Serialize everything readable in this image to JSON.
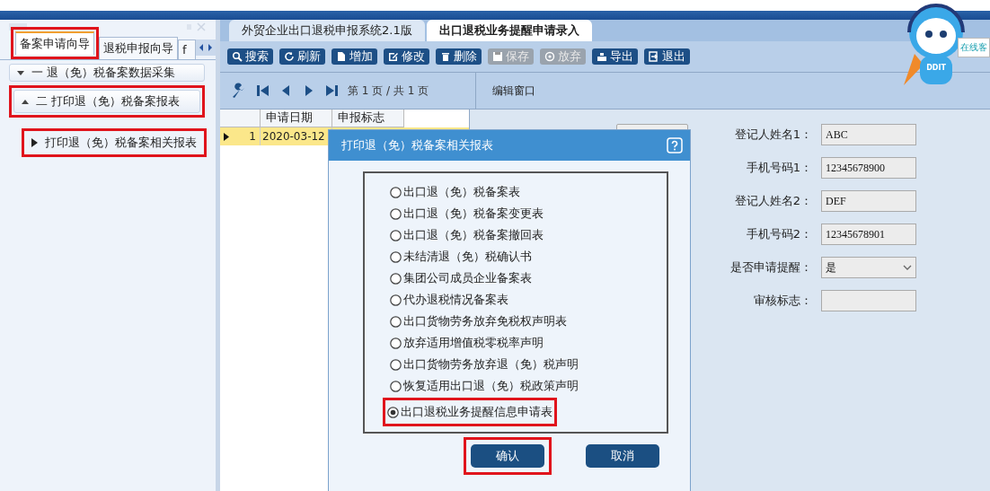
{
  "left_panel": {
    "tabs": [
      {
        "label": "备案申请向导",
        "selected": true,
        "highlighted": true
      },
      {
        "label": "退税申报向导",
        "selected": false,
        "highlighted": false
      },
      {
        "label": "f",
        "selected": false,
        "highlighted": false
      }
    ],
    "tree": [
      {
        "label": "一 退（免）税备案数据采集",
        "expanded": false,
        "highlighted": false
      },
      {
        "label": "二 打印退（免）税备案报表",
        "expanded": true,
        "highlighted": true,
        "children": [
          {
            "label": "打印退（免）税备案相关报表",
            "highlighted": true
          }
        ]
      }
    ]
  },
  "tabs": [
    {
      "label": "外贸企业出口退税申报系统2.1版",
      "selected": false
    },
    {
      "label": "出口退税业务提醒申请录入",
      "selected": true
    }
  ],
  "toolbar": [
    {
      "label": "搜索",
      "kind": "search",
      "disabled": false
    },
    {
      "label": "刷新",
      "kind": "refresh",
      "disabled": false
    },
    {
      "label": "增加",
      "kind": "add",
      "disabled": false
    },
    {
      "label": "修改",
      "kind": "edit",
      "disabled": false
    },
    {
      "label": "删除",
      "kind": "delete",
      "disabled": false
    },
    {
      "label": "保存",
      "kind": "save",
      "disabled": true
    },
    {
      "label": "放弃",
      "kind": "discard",
      "disabled": true
    },
    {
      "label": "导出",
      "kind": "export",
      "disabled": false
    },
    {
      "label": "退出",
      "kind": "exit",
      "disabled": false
    }
  ],
  "pager": {
    "text": "第 1 页 / 共 1 页"
  },
  "edit_window": {
    "title": "编辑窗口"
  },
  "grid": {
    "columns": [
      "申请日期",
      "申报标志"
    ],
    "rows": [
      {
        "index": "1",
        "current": true,
        "cells": [
          "2020-03-12"
        ]
      }
    ]
  },
  "form": {
    "fields": [
      {
        "label": "登记人姓名1：",
        "value": "ABC",
        "kind": "text"
      },
      {
        "label": "手机号码1：",
        "value": "12345678900",
        "kind": "text"
      },
      {
        "label": "登记人姓名2：",
        "value": "DEF",
        "kind": "text"
      },
      {
        "label": "手机号码2：",
        "value": "12345678901",
        "kind": "text"
      },
      {
        "label": "是否申请提醒：",
        "value": "是",
        "kind": "select"
      },
      {
        "label": "审核标志：",
        "kind": "text"
      }
    ]
  },
  "assistant": {
    "badge": "DDIT",
    "bubble": "在线客"
  },
  "dialog": {
    "title": "打印退（免）税备案相关报表",
    "options": [
      {
        "label": "出口退（免）税备案表",
        "selected": false,
        "highlighted": false
      },
      {
        "label": "出口退（免）税备案变更表",
        "selected": false,
        "highlighted": false
      },
      {
        "label": "出口退（免）税备案撤回表",
        "selected": false,
        "highlighted": false
      },
      {
        "label": "未结清退（免）税确认书",
        "selected": false,
        "highlighted": false
      },
      {
        "label": "集团公司成员企业备案表",
        "selected": false,
        "highlighted": false
      },
      {
        "label": "代办退税情况备案表",
        "selected": false,
        "highlighted": false
      },
      {
        "label": "出口货物劳务放弃免税权声明表",
        "selected": false,
        "highlighted": false
      },
      {
        "label": "放弃适用增值税零税率声明",
        "selected": false,
        "highlighted": false
      },
      {
        "label": "出口货物劳务放弃退（免）税声明",
        "selected": false,
        "highlighted": false
      },
      {
        "label": "恢复适用出口退（免）税政策声明",
        "selected": false,
        "highlighted": false
      },
      {
        "label": "出口退税业务提醒信息申请表",
        "selected": true,
        "highlighted": true
      }
    ],
    "buttons": [
      {
        "label": "确认",
        "highlighted": true
      },
      {
        "label": "取消",
        "highlighted": false
      }
    ]
  }
}
